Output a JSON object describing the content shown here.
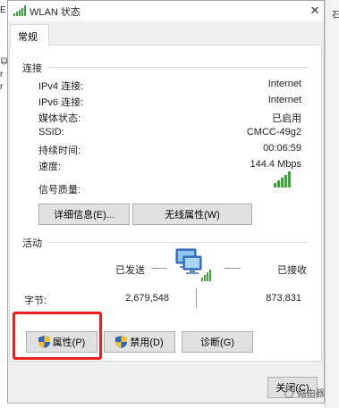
{
  "window": {
    "title": "WLAN 状态"
  },
  "tabs": [
    {
      "label": "常规"
    }
  ],
  "connection": {
    "section_title": "连接",
    "rows": [
      {
        "label": "IPv4 连接:",
        "value": "Internet"
      },
      {
        "label": "IPv6 连接:",
        "value": "Internet"
      },
      {
        "label": "媒体状态:",
        "value": "已启用"
      },
      {
        "label": "SSID:",
        "value": "CMCC-49g2"
      },
      {
        "label": "持续时间:",
        "value": "00:06:59"
      },
      {
        "label": "速度:",
        "value": "144.4 Mbps"
      }
    ],
    "signal_label": "信号质量:",
    "signal_bars": 5,
    "details_button": "详细信息(E)...",
    "wireless_props_button": "无线属性(W)"
  },
  "activity": {
    "section_title": "活动",
    "sent_label": "已发送",
    "received_label": "已接收",
    "bytes_label": "字节:",
    "bytes_sent": "2,679,548",
    "bytes_received": "873,831"
  },
  "buttons": {
    "properties": "属性(P)",
    "disable": "禁用(D)",
    "diagnose": "诊断(G)",
    "close": "关闭(C)"
  },
  "background": {
    "left_chars": [
      "E",
      "以",
      "r",
      "r"
    ],
    "right_char": "石"
  },
  "watermark": "路由器",
  "colors": {
    "highlight": "#e82020",
    "signal": "#3aa53a",
    "panel_border": "#d9d9d9"
  }
}
